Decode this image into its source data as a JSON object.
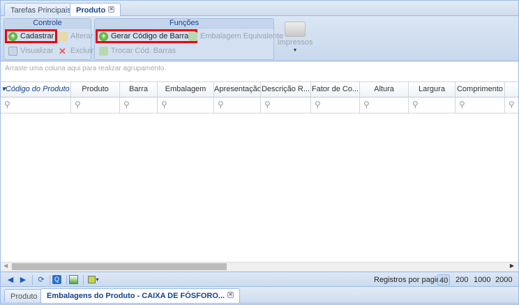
{
  "tabs": [
    {
      "label": "Tarefas Principais"
    },
    {
      "label": "Produto"
    }
  ],
  "toolbar": {
    "controle": {
      "title": "Controle",
      "cadastrar": "Cadastrar",
      "alterar": "Alterar",
      "visualizar": "Visualizar",
      "excluir": "Excluir"
    },
    "funcoes": {
      "title": "Funções",
      "gerar": "Gerar Código de Barras",
      "embalagem": "Embalagem Equivalente",
      "trocar": "Trocar Cód. Barras"
    },
    "impressos": "Impressos"
  },
  "group_hint": "Arraste uma coluna aqui para realizar agrupamento.",
  "columns": [
    "▾Código do Produto",
    "Produto",
    "Barra",
    "Embalagem",
    "Apresentação",
    "Descrição R...",
    "Fator de Co...",
    "Altura",
    "Largura",
    "Comprimento",
    ""
  ],
  "pager": {
    "label": "Registros por pagina:",
    "sizes": [
      "40",
      "200",
      "1000",
      "2000"
    ],
    "selected": "40"
  },
  "bottom_tabs": [
    {
      "label": "Produto"
    },
    {
      "label": "Embalagens do Produto - CAIXA DE FÓSFORO..."
    }
  ]
}
